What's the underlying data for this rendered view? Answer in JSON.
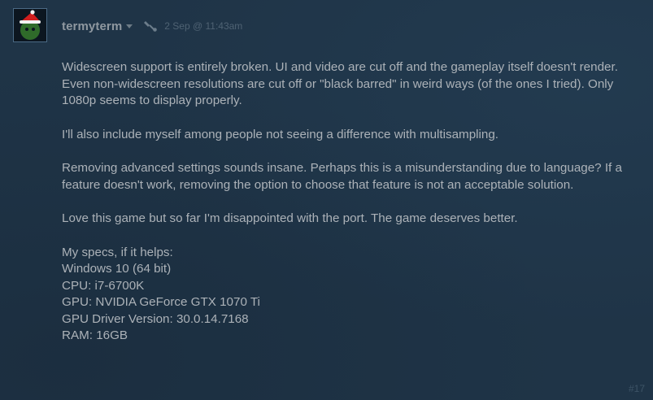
{
  "post": {
    "author": "termyterm",
    "date": "2 Sep @ 11:43am",
    "number": "#17",
    "paragraphs": [
      "Widescreen support is entirely broken. UI and video are cut off and the gameplay itself doesn't render. Even non-widescreen resolutions are cut off or \"black barred\" in weird ways (of the ones I tried). Only 1080p seems to display properly.",
      "I'll also include myself among people not seeing a difference with multisampling.",
      "Removing advanced settings sounds insane. Perhaps this is a misunderstanding due to language? If a feature doesn't work, removing the option to choose that feature is not an acceptable solution.",
      "Love this game but so far I'm disappointed with the port. The game deserves better."
    ],
    "specs": [
      "My specs, if it helps:",
      "Windows 10 (64 bit)",
      "CPU: i7-6700K",
      "GPU: NVIDIA GeForce GTX 1070 Ti",
      "GPU Driver Version: 30.0.14.7168",
      "RAM: 16GB"
    ]
  },
  "colors": {
    "background": "#1f3447",
    "author": "#8f98a0",
    "body_text": "#acb2b8",
    "date": "#4f6273"
  },
  "icons": {
    "avatar": "avatar-santa-hat",
    "author_menu": "chevron-down-icon",
    "award": "award-icon"
  }
}
